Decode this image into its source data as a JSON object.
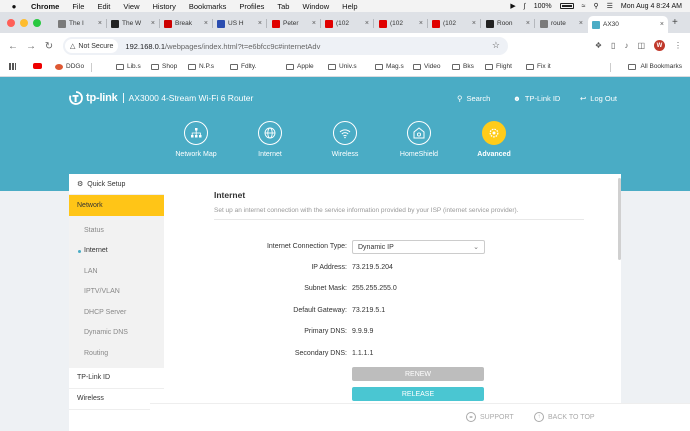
{
  "menubar": {
    "apple": "",
    "app": "Chrome",
    "items": [
      "File",
      "Edit",
      "View",
      "History",
      "Bookmarks",
      "Profiles",
      "Tab",
      "Window",
      "Help"
    ],
    "battery": "100%",
    "datetime": "Mon Aug 4  8:24 AM"
  },
  "tabs": [
    {
      "label": "The I",
      "favicon": "tab-favicon",
      "color": "#7a7a7a"
    },
    {
      "label": "The W",
      "favicon": "wapo-icon",
      "color": "#222222"
    },
    {
      "label": "Break",
      "favicon": "cnn-icon",
      "color": "#cc0000"
    },
    {
      "label": "US H",
      "favicon": "news-icon",
      "color": "#2b4db0"
    },
    {
      "label": "Peter",
      "favicon": "youtube-icon",
      "color": "#e00000"
    },
    {
      "label": "(102",
      "favicon": "youtube-icon",
      "color": "#e00000"
    },
    {
      "label": "(102",
      "favicon": "youtube-icon",
      "color": "#e00000"
    },
    {
      "label": "(102",
      "favicon": "youtube-icon",
      "color": "#e00000"
    },
    {
      "label": "Roon",
      "favicon": "roon-icon",
      "color": "#222222"
    },
    {
      "label": "route",
      "favicon": "router-icon",
      "color": "#7a7a7a"
    },
    {
      "label": "AX30",
      "favicon": "tplink-icon",
      "color": "#4aacc5",
      "active": true
    }
  ],
  "toolbar": {
    "security_label": "Not Secure",
    "url_host": "192.168.0.1",
    "url_path": "/webpages/index.html?t=e6bfcc9c#internetAdv",
    "profile_initial": "W"
  },
  "bookmarks": {
    "items": [
      "DDGo",
      "Lib.s",
      "Shop",
      "N.P.s",
      "Fdlty.",
      "Apple",
      "Univ.s",
      "Mag.s",
      "Video",
      "Bks",
      "Flight",
      "Fix it"
    ],
    "all_label": "All Bookmarks"
  },
  "router": {
    "brand": "tp-link",
    "model": "AX3000 4-Stream Wi-Fi 6 Router",
    "header_links": {
      "search": "Search",
      "tplink_id": "TP-Link ID",
      "logout": "Log Out"
    },
    "main_nav": [
      {
        "label": "Network Map",
        "icon": "network-map-icon"
      },
      {
        "label": "Internet",
        "icon": "globe-icon"
      },
      {
        "label": "Wireless",
        "icon": "wifi-icon"
      },
      {
        "label": "HomeShield",
        "icon": "homeshield-icon"
      },
      {
        "label": "Advanced",
        "icon": "gear-icon",
        "active": true
      }
    ],
    "accent": "#ffc517",
    "header_color": "#4aacc5"
  },
  "sidebar": {
    "quick_setup": "Quick Setup",
    "network": "Network",
    "sub_items": [
      "Status",
      "Internet",
      "LAN",
      "IPTV/VLAN",
      "DHCP Server",
      "Dynamic DNS",
      "Routing"
    ],
    "active_sub": "Internet",
    "lower": [
      "TP-Link ID",
      "Wireless"
    ]
  },
  "internet": {
    "title": "Internet",
    "subtitle": "Set up an internet connection with the service information provided by your ISP (internet service provider).",
    "connection_type_label": "Internet Connection Type:",
    "connection_type_value": "Dynamic IP",
    "fields": [
      {
        "label": "IP Address:",
        "value": "73.219.5.204"
      },
      {
        "label": "Subnet Mask:",
        "value": "255.255.255.0"
      },
      {
        "label": "Default Gateway:",
        "value": "73.219.5.1"
      },
      {
        "label": "Primary DNS:",
        "value": "9.9.9.9"
      },
      {
        "label": "Secondary DNS:",
        "value": "1.1.1.1"
      }
    ],
    "renew_label": "RENEW",
    "release_label": "RELEASE"
  },
  "footer": {
    "support": "SUPPORT",
    "back_to_top": "BACK TO TOP"
  }
}
